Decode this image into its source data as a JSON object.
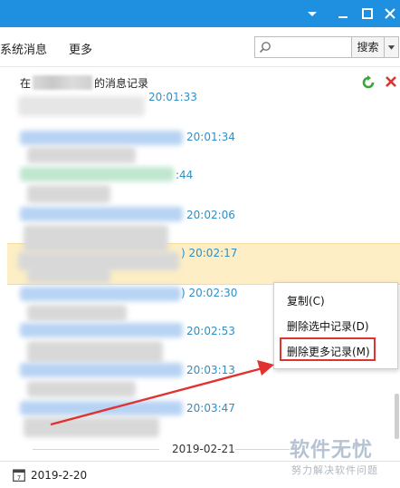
{
  "window": {
    "accent": "#1f8fe0"
  },
  "toolbar": {
    "system_messages": "系统消息",
    "more": "更多",
    "search_value": "",
    "search_button": "搜索"
  },
  "history": {
    "title_prefix": "在",
    "title_suffix": "的消息记录"
  },
  "messages": [
    {
      "time": "20:01:33"
    },
    {
      "time": "20:01:34"
    },
    {
      "time": ":44"
    },
    {
      "time": "20:02:06"
    },
    {
      "time": ") 20:02:17",
      "highlighted": true
    },
    {
      "time": ") 20:02:30"
    },
    {
      "time": "20:02:53"
    },
    {
      "time": "20:03:13"
    },
    {
      "time": "20:03:47"
    }
  ],
  "date_separator": "2019-02-21",
  "footer": {
    "date": "2019-2-20"
  },
  "context_menu": {
    "items": [
      {
        "label": "复制(C)"
      },
      {
        "label": "删除选中记录(D)"
      },
      {
        "label": "删除更多记录(M)",
        "highlighted": true
      }
    ]
  },
  "watermark": {
    "title": "软件无忧",
    "subtitle": "努力解决软件问题"
  },
  "colors": {
    "time_text": "#2f8fc6",
    "highlight_row": "#fdeec5",
    "annotation_red": "#e0322f"
  }
}
